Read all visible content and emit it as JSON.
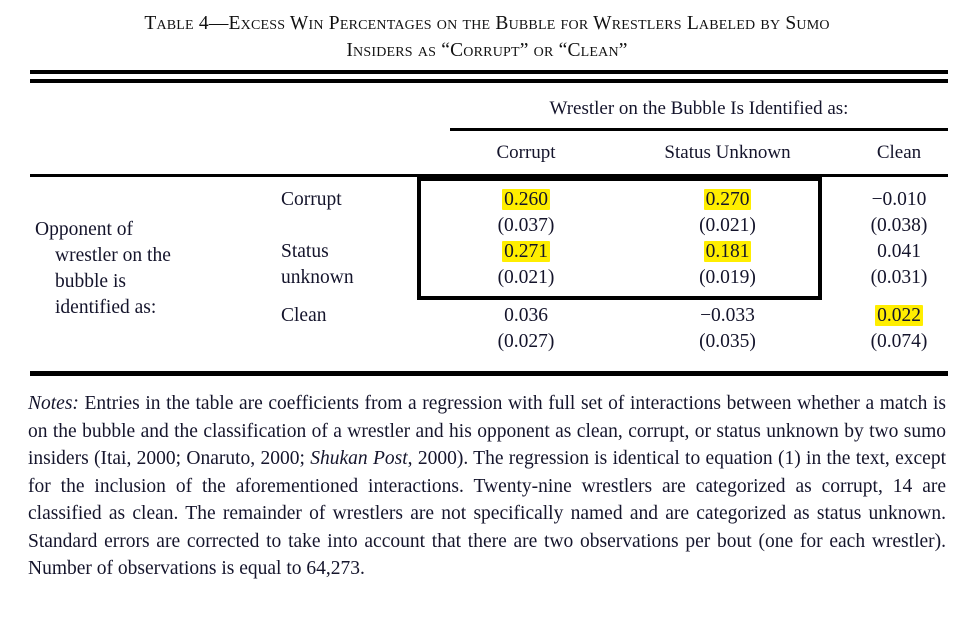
{
  "title": {
    "line1": "Table 4—Excess Win Percentages on the Bubble for Wrestlers Labeled by Sumo",
    "line2": "Insiders as “Corrupt” or “Clean”"
  },
  "table": {
    "spanner_label": "Wrestler on the Bubble Is Identified as:",
    "column_headers": [
      "Corrupt",
      "Status Unknown",
      "Clean"
    ],
    "stub_caption_lines": [
      "Opponent of",
      "wrestler on the",
      "bubble is",
      "identified as:"
    ],
    "row_labels": [
      "Corrupt",
      "Status\nunknown",
      "Clean"
    ],
    "row_labels_flat": [
      "Corrupt",
      "Status unknown",
      "Clean"
    ],
    "highlight_color": "#ffee00",
    "cells": {
      "r1": {
        "corrupt_coef": "0.260",
        "corrupt_se": "(0.037)",
        "unknown_coef": "0.270",
        "unknown_se": "(0.021)",
        "clean_coef": "−0.010",
        "clean_se": "(0.038)"
      },
      "r2": {
        "corrupt_coef": "0.271",
        "corrupt_se": "(0.021)",
        "unknown_coef": "0.181",
        "unknown_se": "(0.019)",
        "clean_coef": "0.041",
        "clean_se": "(0.031)"
      },
      "r3": {
        "corrupt_coef": "0.036",
        "corrupt_se": "(0.027)",
        "unknown_coef": "−0.033",
        "unknown_se": "(0.035)",
        "clean_coef": "0.022",
        "clean_se": "(0.074)"
      }
    }
  },
  "chart_data": {
    "type": "table",
    "title": "Table 4—Excess Win Percentages on the Bubble for Wrestlers Labeled by Sumo Insiders as “Corrupt” or “Clean”",
    "column_spanner": "Wrestler on the Bubble Is Identified as:",
    "row_spanner": "Opponent of wrestler on the bubble is identified as:",
    "columns": [
      "Corrupt",
      "Status Unknown",
      "Clean"
    ],
    "rows": [
      "Corrupt",
      "Status unknown",
      "Clean"
    ],
    "coefficients": [
      [
        0.26,
        0.27,
        -0.01
      ],
      [
        0.271,
        0.181,
        0.041
      ],
      [
        0.036,
        -0.033,
        0.022
      ]
    ],
    "standard_errors": [
      [
        0.037,
        0.021,
        0.038
      ],
      [
        0.021,
        0.019,
        0.031
      ],
      [
        0.027,
        0.035,
        0.074
      ]
    ],
    "highlighted_cells": [
      {
        "row": "Corrupt",
        "col": "Corrupt",
        "value": 0.26
      },
      {
        "row": "Corrupt",
        "col": "Status Unknown",
        "value": 0.27
      },
      {
        "row": "Status unknown",
        "col": "Corrupt",
        "value": 0.271
      },
      {
        "row": "Status unknown",
        "col": "Status Unknown",
        "value": 0.181
      },
      {
        "row": "Clean",
        "col": "Clean",
        "value": 0.022
      }
    ],
    "boxed_region": {
      "rows": [
        "Corrupt",
        "Status unknown"
      ],
      "cols": [
        "Corrupt",
        "Status Unknown"
      ]
    },
    "n_observations": 64273,
    "n_corrupt_wrestlers": 29,
    "n_clean_wrestlers": 14
  },
  "notes": {
    "lead": "Notes:",
    "body_1": " Entries in the table are coefficients from a regression with full set of interactions between whether a match is on the bubble and the classification of a wrestler and his opponent as clean, corrupt, or status unknown by two sumo insiders (Itai, 2000; Onaruto, 2000; ",
    "italic_1": "Shukan Post",
    "body_2": ", 2000). The regression is identical to equation (1) in the text, except for the inclusion of the aforementioned interactions. Twenty-nine wrestlers are categorized as corrupt, 14 are classified as clean. The remainder of wrestlers are not specifically named and are categorized as status unknown. Standard errors are corrected to take into account that there are two observations per bout (one for each wrestler). Number of observations is equal to 64,273."
  }
}
